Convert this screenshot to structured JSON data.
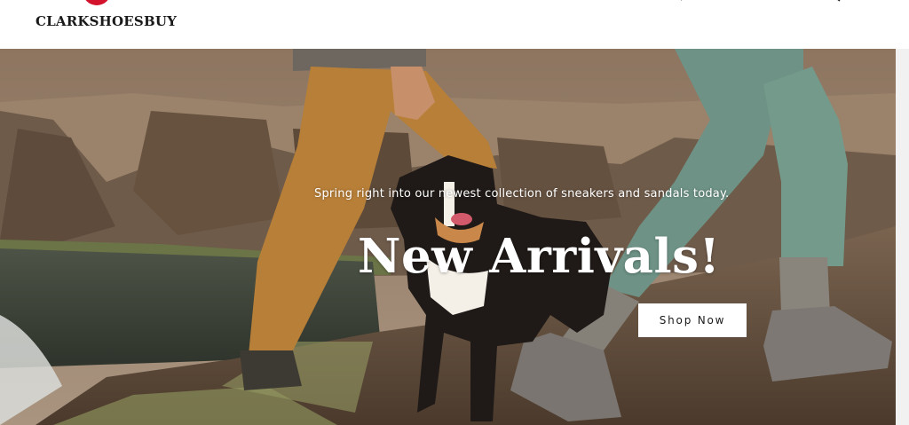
{
  "header": {
    "brand": "CLARKSHOESBUY",
    "brand_color": "#d3132c",
    "icons": [
      "search-icon",
      "account-icon",
      "search-icon",
      "cart-icon"
    ]
  },
  "hero": {
    "subtitle": "Spring right into our newest collection of sneakers and sandals today.",
    "headline": "New Arrivals!",
    "cta_label": "Shop Now"
  }
}
